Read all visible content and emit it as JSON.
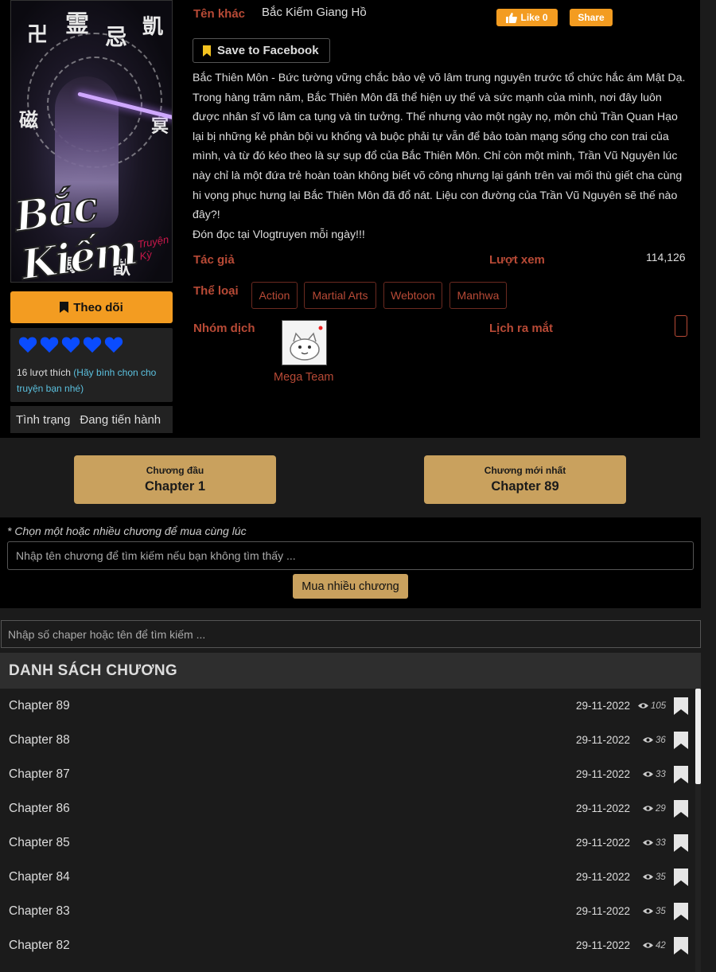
{
  "cover": {
    "title_art": "Bắc Kiếm",
    "subtitle_art": "Truyện Kỳ"
  },
  "sidebar": {
    "follow_label": "Theo dõi",
    "rating_hearts": 5,
    "likes_count": "16 lượt thích",
    "likes_hint": "(Hãy bình chọn cho truyện bạn nhé)",
    "status_label": "Tình trạng",
    "status_value": "Đang tiến hành"
  },
  "info": {
    "alt_name_label": "Tên khác",
    "alt_name": "Bắc Kiếm Giang Hồ",
    "like_label": "Like 0",
    "share_label": "Share",
    "save_fb_label": "Save to Facebook",
    "description": [
      "Bắc Thiên Môn - Bức tường vững chắc bảo vệ võ lâm trung nguyên trước tổ chức hắc ám Mật Dạ. Trong hàng trăm năm, Bắc Thiên Môn đã thể hiện uy thế và sức mạnh của mình, nơi đây luôn được nhân sĩ võ lâm ca tụng và tin tưởng. Thế nhưng vào một ngày nọ, môn chủ Trần Quan Hạo lại bị những kẻ phản bội vu khống và buộc phải tự vẫn để bảo toàn mạng sống cho con trai của mình, và từ đó kéo theo là sự sụp đổ của Bắc Thiên Môn. Chỉ còn một mình, Trần Vũ Nguyên lúc này chỉ là một đứa trẻ hoàn toàn không biết võ công nhưng lại gánh trên vai mối thù giết cha cùng hi vọng phục hưng lại Bắc Thiên Môn đã đổ nát. Liệu con đường của Trần Vũ Nguyên sẽ thế nào đây?!",
      "Đón đọc tại Vlogtruyen mỗi ngày!!!"
    ],
    "author_label": "Tác giả",
    "views_label": "Lượt xem",
    "views_value": "114,126",
    "genre_label": "Thể loại",
    "genres": [
      "Action",
      "Martial Arts",
      "Webtoon",
      "Manhwa"
    ],
    "team_label": "Nhóm dịch",
    "team_name": "Mega Team",
    "release_label": "Lịch ra mắt"
  },
  "chapter_nav": {
    "first_small": "Chương đầu",
    "first_big": "Chapter 1",
    "latest_small": "Chương mới nhất",
    "latest_big": "Chapter 89"
  },
  "buy": {
    "note": "* Chọn một hoặc nhiều chương để mua cùng lúc",
    "search_placeholder": "Nhập tên chương để tìm kiếm nếu bạn không tìm thấy ...",
    "button_label": "Mua nhiều chương"
  },
  "chapter_search_placeholder": "Nhập số chaper hoặc tên để tìm kiếm ...",
  "list_title": "DANH SÁCH CHƯƠNG",
  "chapters": [
    {
      "name": "Chapter 89",
      "date": "29-11-2022",
      "views": "105"
    },
    {
      "name": "Chapter 88",
      "date": "29-11-2022",
      "views": "36"
    },
    {
      "name": "Chapter 87",
      "date": "29-11-2022",
      "views": "33"
    },
    {
      "name": "Chapter 86",
      "date": "29-11-2022",
      "views": "29"
    },
    {
      "name": "Chapter 85",
      "date": "29-11-2022",
      "views": "33"
    },
    {
      "name": "Chapter 84",
      "date": "29-11-2022",
      "views": "35"
    },
    {
      "name": "Chapter 83",
      "date": "29-11-2022",
      "views": "35"
    },
    {
      "name": "Chapter 82",
      "date": "29-11-2022",
      "views": "42"
    }
  ],
  "colors": {
    "accent": "#f39c21",
    "gold": "#c9a15e",
    "label_red": "#b84a36",
    "heart_blue": "#0a4cff"
  }
}
